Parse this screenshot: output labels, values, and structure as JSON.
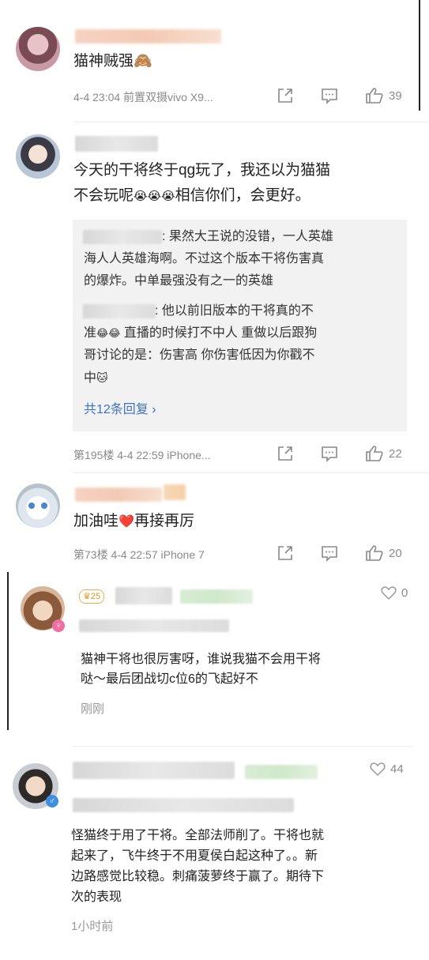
{
  "comments": [
    {
      "text": "猫神贼强",
      "emoji": "🙈",
      "meta": "4-4 23:04  前置双摄vivo X9...",
      "likes": "39"
    },
    {
      "text_line1": "今天的干将终于qg玩了，我还以为猫猫",
      "text_line2_a": "不会玩呢",
      "text_line2_emoji": "😭😭😭",
      "text_line2_b": "相信你们，会更好。",
      "replies": [
        {
          "line1": ": 果然大王说的没错，一人英雄",
          "line2": "海人人英雄海啊。不过这个版本干将伤害真",
          "line3": "的爆炸。中单最强没有之一的英雄"
        },
        {
          "line1": ": 他以前旧版本的干将真的不",
          "line2_a": "准",
          "line2_emoji": "😂😂",
          "line2_b": " 直播的时候打不中人 重做以后跟狗",
          "line3": "哥讨论的是：伤害高 你伤害低因为你戳不",
          "line4_a": "中",
          "line4_emoji": "🐱"
        }
      ],
      "more_replies": "共12条回复 ›",
      "meta": "第195楼  4-4 22:59  iPhone...",
      "likes": "22"
    },
    {
      "text_a": "加油哇",
      "text_emoji": "❤️",
      "text_b": "再接再厉",
      "meta": "第73楼  4-4 22:57  iPhone 7",
      "likes": "20"
    },
    {
      "level_badge": "♛25",
      "likes": "0",
      "text_line1": "猫神干将也很厉害呀，谁说我猫不会用干将",
      "text_line2": "哒～最后团战切c位6的飞起好不",
      "time": "刚刚"
    },
    {
      "likes": "44",
      "text_line1": "怪猫终于用了干将。全部法师削了。干将也就",
      "text_line2": "起来了，飞牛终于不用夏侯白起这种了。。新",
      "text_line3": "边路感觉比较稳。刺痛菠萝终于赢了。期待下",
      "text_line4": "次的表现",
      "time": "1小时前"
    }
  ],
  "colors": {
    "link": "#3f73c4",
    "meta": "#8a8a8a",
    "reply_bg": "#f2f2f2"
  }
}
